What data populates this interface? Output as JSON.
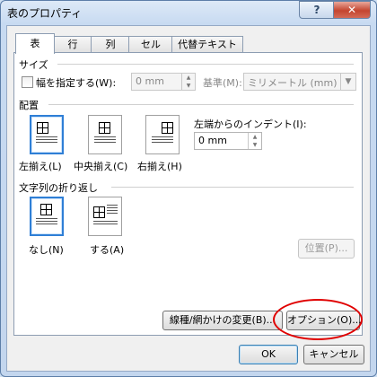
{
  "window": {
    "title": "表のプロパティ",
    "help_glyph": "?",
    "close_glyph": "✕"
  },
  "tabs": [
    "表",
    "行",
    "列",
    "セル",
    "代替テキスト"
  ],
  "size": {
    "heading": "サイズ",
    "width_checkbox_label": "幅を指定する(W):",
    "width_value": "0 mm",
    "unit_label": "基準(M):",
    "unit_value": "ミリメートル (mm)"
  },
  "alignment": {
    "heading": "配置",
    "options": [
      "左揃え(L)",
      "中央揃え(C)",
      "右揃え(H)"
    ],
    "indent_label": "左端からのインデント(I):",
    "indent_value": "0 mm"
  },
  "wrapping": {
    "heading": "文字列の折り返し",
    "options": [
      "なし(N)",
      "する(A)"
    ],
    "position_button": "位置(P)..."
  },
  "bottom": {
    "borders_button": "線種/網かけの変更(B)...",
    "options_button": "オプション(O)..."
  },
  "dialog_buttons": {
    "ok": "OK",
    "cancel": "キャンセル"
  },
  "colors": {
    "highlight_oval": "#e00000",
    "selected_border": "#2f7fd6"
  }
}
